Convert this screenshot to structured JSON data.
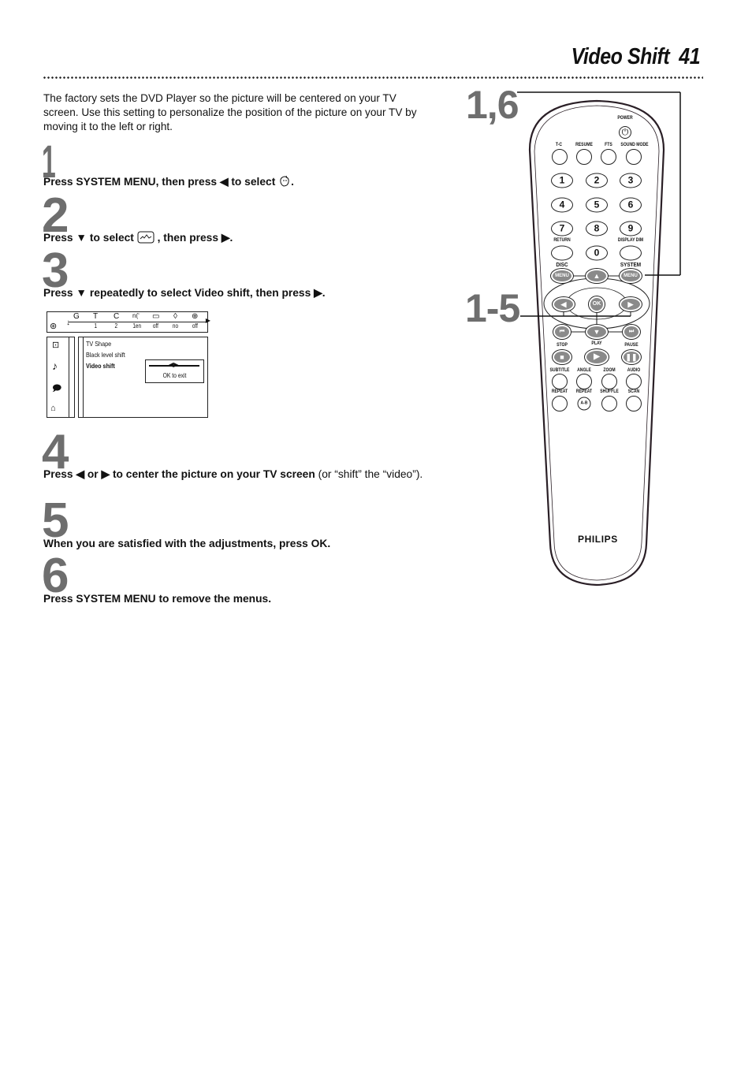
{
  "header": {
    "title": "Video Shift",
    "page_number": "41"
  },
  "intro": "The factory sets the DVD Player so the picture will be centered on your TV screen. Use this setting to personalize the position of the picture on your TV by moving it to the left or right.",
  "steps": [
    {
      "number": "1",
      "bold_before": "Press SYSTEM MENU, then press ◀ to select ",
      "icon": "system-menu-icon",
      "bold_after": "."
    },
    {
      "number": "2",
      "bold_before": "Press ▼ to select ",
      "icon": "picture-settings-icon",
      "bold_after": " , then press ▶."
    },
    {
      "number": "3",
      "bold_before": "Press ▼ repeatedly to select Video shift, then press ▶."
    },
    {
      "number": "4",
      "bold_before": "Press ◀ or ▶ to center the picture on your TV screen",
      "normal_after": " (or “shift” the “video”)."
    },
    {
      "number": "5",
      "bold_before": "When you are satisfied with the adjustments, press OK."
    },
    {
      "number": "6",
      "bold_before": "Press SYSTEM MENU to remove the menus."
    }
  ],
  "osd": {
    "top_icons": [
      "title-icon",
      "text-icon",
      "chapter-icon",
      "audio-icon",
      "subtitle-icon",
      "angle-icon",
      "zoom-icon"
    ],
    "top_values": [
      "1",
      "2",
      "1en",
      "off",
      "no",
      "off"
    ],
    "side_icons": [
      "picture-icon",
      "sound-icon",
      "language-icon",
      "features-icon"
    ],
    "menu_items": [
      "TV Shape",
      "Black level shift",
      "Video shift"
    ],
    "selected_item": "Video shift",
    "popup_label": "OK to exit"
  },
  "callouts": {
    "top": "1,6",
    "middle": "1-5"
  },
  "remote": {
    "brand": "PHILIPS",
    "power_label": "POWER",
    "top_row": [
      "T-C",
      "RESUME",
      "FTS",
      "SOUND MODE"
    ],
    "digits": [
      "1",
      "2",
      "3",
      "4",
      "5",
      "6",
      "7",
      "8",
      "9",
      "0"
    ],
    "return_label": "RETURN",
    "display_dim_label": "DISPLAY DIM",
    "disc_label": "DISC",
    "system_label": "SYSTEM",
    "menu_label": "MENU",
    "ok_label": "OK",
    "transport_labels": [
      "STOP",
      "PLAY",
      "PAUSE"
    ],
    "row_a": [
      "SUBTITLE",
      "ANGLE",
      "ZOOM",
      "AUDIO"
    ],
    "row_b": [
      "REPEAT",
      "REPEAT",
      "SHUFFLE",
      "SCAN"
    ],
    "ab_label": "A-B"
  }
}
